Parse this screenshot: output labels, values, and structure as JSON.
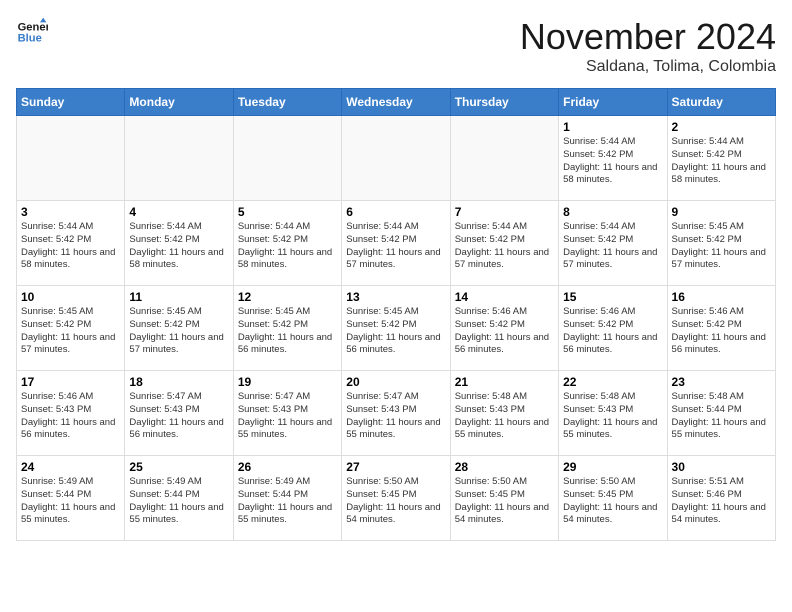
{
  "logo": {
    "line1": "General",
    "line2": "Blue"
  },
  "title": "November 2024",
  "subtitle": "Saldana, Tolima, Colombia",
  "days_of_week": [
    "Sunday",
    "Monday",
    "Tuesday",
    "Wednesday",
    "Thursday",
    "Friday",
    "Saturday"
  ],
  "weeks": [
    [
      {
        "day": "",
        "info": ""
      },
      {
        "day": "",
        "info": ""
      },
      {
        "day": "",
        "info": ""
      },
      {
        "day": "",
        "info": ""
      },
      {
        "day": "",
        "info": ""
      },
      {
        "day": "1",
        "info": "Sunrise: 5:44 AM\nSunset: 5:42 PM\nDaylight: 11 hours and 58 minutes."
      },
      {
        "day": "2",
        "info": "Sunrise: 5:44 AM\nSunset: 5:42 PM\nDaylight: 11 hours and 58 minutes."
      }
    ],
    [
      {
        "day": "3",
        "info": "Sunrise: 5:44 AM\nSunset: 5:42 PM\nDaylight: 11 hours and 58 minutes."
      },
      {
        "day": "4",
        "info": "Sunrise: 5:44 AM\nSunset: 5:42 PM\nDaylight: 11 hours and 58 minutes."
      },
      {
        "day": "5",
        "info": "Sunrise: 5:44 AM\nSunset: 5:42 PM\nDaylight: 11 hours and 58 minutes."
      },
      {
        "day": "6",
        "info": "Sunrise: 5:44 AM\nSunset: 5:42 PM\nDaylight: 11 hours and 57 minutes."
      },
      {
        "day": "7",
        "info": "Sunrise: 5:44 AM\nSunset: 5:42 PM\nDaylight: 11 hours and 57 minutes."
      },
      {
        "day": "8",
        "info": "Sunrise: 5:44 AM\nSunset: 5:42 PM\nDaylight: 11 hours and 57 minutes."
      },
      {
        "day": "9",
        "info": "Sunrise: 5:45 AM\nSunset: 5:42 PM\nDaylight: 11 hours and 57 minutes."
      }
    ],
    [
      {
        "day": "10",
        "info": "Sunrise: 5:45 AM\nSunset: 5:42 PM\nDaylight: 11 hours and 57 minutes."
      },
      {
        "day": "11",
        "info": "Sunrise: 5:45 AM\nSunset: 5:42 PM\nDaylight: 11 hours and 57 minutes."
      },
      {
        "day": "12",
        "info": "Sunrise: 5:45 AM\nSunset: 5:42 PM\nDaylight: 11 hours and 56 minutes."
      },
      {
        "day": "13",
        "info": "Sunrise: 5:45 AM\nSunset: 5:42 PM\nDaylight: 11 hours and 56 minutes."
      },
      {
        "day": "14",
        "info": "Sunrise: 5:46 AM\nSunset: 5:42 PM\nDaylight: 11 hours and 56 minutes."
      },
      {
        "day": "15",
        "info": "Sunrise: 5:46 AM\nSunset: 5:42 PM\nDaylight: 11 hours and 56 minutes."
      },
      {
        "day": "16",
        "info": "Sunrise: 5:46 AM\nSunset: 5:42 PM\nDaylight: 11 hours and 56 minutes."
      }
    ],
    [
      {
        "day": "17",
        "info": "Sunrise: 5:46 AM\nSunset: 5:43 PM\nDaylight: 11 hours and 56 minutes."
      },
      {
        "day": "18",
        "info": "Sunrise: 5:47 AM\nSunset: 5:43 PM\nDaylight: 11 hours and 56 minutes."
      },
      {
        "day": "19",
        "info": "Sunrise: 5:47 AM\nSunset: 5:43 PM\nDaylight: 11 hours and 55 minutes."
      },
      {
        "day": "20",
        "info": "Sunrise: 5:47 AM\nSunset: 5:43 PM\nDaylight: 11 hours and 55 minutes."
      },
      {
        "day": "21",
        "info": "Sunrise: 5:48 AM\nSunset: 5:43 PM\nDaylight: 11 hours and 55 minutes."
      },
      {
        "day": "22",
        "info": "Sunrise: 5:48 AM\nSunset: 5:43 PM\nDaylight: 11 hours and 55 minutes."
      },
      {
        "day": "23",
        "info": "Sunrise: 5:48 AM\nSunset: 5:44 PM\nDaylight: 11 hours and 55 minutes."
      }
    ],
    [
      {
        "day": "24",
        "info": "Sunrise: 5:49 AM\nSunset: 5:44 PM\nDaylight: 11 hours and 55 minutes."
      },
      {
        "day": "25",
        "info": "Sunrise: 5:49 AM\nSunset: 5:44 PM\nDaylight: 11 hours and 55 minutes."
      },
      {
        "day": "26",
        "info": "Sunrise: 5:49 AM\nSunset: 5:44 PM\nDaylight: 11 hours and 55 minutes."
      },
      {
        "day": "27",
        "info": "Sunrise: 5:50 AM\nSunset: 5:45 PM\nDaylight: 11 hours and 54 minutes."
      },
      {
        "day": "28",
        "info": "Sunrise: 5:50 AM\nSunset: 5:45 PM\nDaylight: 11 hours and 54 minutes."
      },
      {
        "day": "29",
        "info": "Sunrise: 5:50 AM\nSunset: 5:45 PM\nDaylight: 11 hours and 54 minutes."
      },
      {
        "day": "30",
        "info": "Sunrise: 5:51 AM\nSunset: 5:46 PM\nDaylight: 11 hours and 54 minutes."
      }
    ]
  ]
}
